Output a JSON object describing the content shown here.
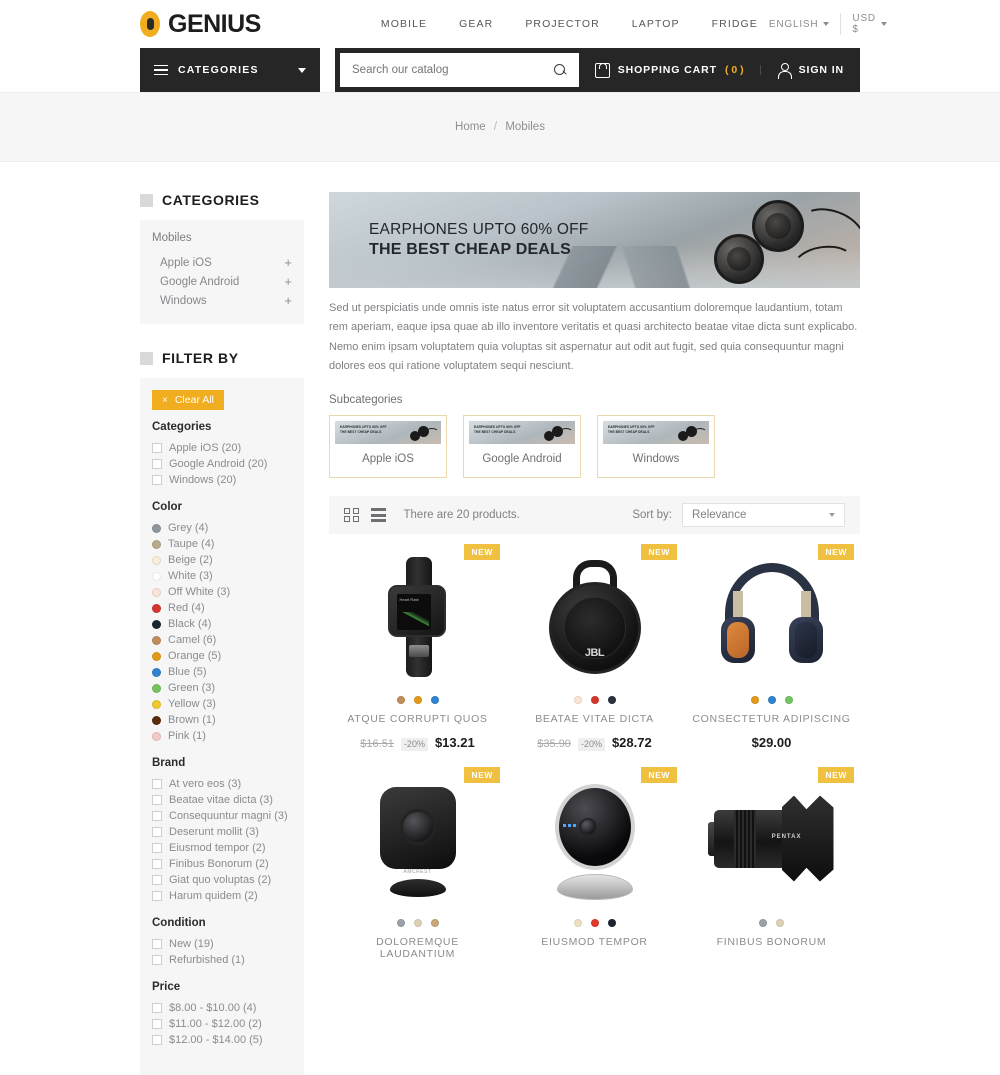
{
  "header": {
    "brand": "GENIUS",
    "nav": [
      "MOBILE",
      "GEAR",
      "PROJECTOR",
      "LAPTOP",
      "FRIDGE"
    ],
    "language": "ENGLISH",
    "currency": "USD $"
  },
  "darkbar": {
    "categories_label": "CATEGORIES",
    "search_placeholder": "Search our catalog",
    "cart_label": "SHOPPING CART",
    "cart_count": "( 0 )",
    "signin_label": "SIGN IN"
  },
  "breadcrumb": {
    "home": "Home",
    "sep": "/",
    "current": "Mobiles"
  },
  "sidebar": {
    "categories_title": "CATEGORIES",
    "root": "Mobiles",
    "items": [
      {
        "label": "Apple iOS",
        "expand": "+"
      },
      {
        "label": "Google Android",
        "expand": "+"
      },
      {
        "label": "Windows",
        "expand": "+"
      }
    ],
    "filter_title": "FILTER BY",
    "clear_all": "Clear All",
    "clear_x": "×",
    "groups": [
      {
        "name": "Categories",
        "type": "checkbox",
        "options": [
          "Apple iOS (20)",
          "Google Android (20)",
          "Windows (20)"
        ]
      },
      {
        "name": "Color",
        "type": "swatch",
        "options": [
          {
            "label": "Grey (4)",
            "color": "#8f969c"
          },
          {
            "label": "Taupe (4)",
            "color": "#b9ab8a"
          },
          {
            "label": "Beige (2)",
            "color": "#f6efd9"
          },
          {
            "label": "White (3)",
            "color": "#ffffff"
          },
          {
            "label": "Off White (3)",
            "color": "#fbe3d6"
          },
          {
            "label": "Red (4)",
            "color": "#d2362c"
          },
          {
            "label": "Black (4)",
            "color": "#1e2532"
          },
          {
            "label": "Camel (6)",
            "color": "#c08d5d"
          },
          {
            "label": "Orange (5)",
            "color": "#e39a18"
          },
          {
            "label": "Blue (5)",
            "color": "#3183d0"
          },
          {
            "label": "Green (3)",
            "color": "#76c461"
          },
          {
            "label": "Yellow (3)",
            "color": "#f0c92b"
          },
          {
            "label": "Brown (1)",
            "color": "#5a2b0c"
          },
          {
            "label": "Pink (1)",
            "color": "#f2cbc7"
          }
        ]
      },
      {
        "name": "Brand",
        "type": "checkbox",
        "options": [
          "At vero eos (3)",
          "Beatae vitae dicta (3)",
          "Consequuntur magni (3)",
          "Deserunt mollit (3)",
          "Eiusmod tempor (2)",
          "Finibus Bonorum (2)",
          "Giat quo voluptas (2)",
          "Harum quidem (2)"
        ]
      },
      {
        "name": "Condition",
        "type": "checkbox",
        "options": [
          "New (19)",
          "Refurbished (1)"
        ]
      },
      {
        "name": "Price",
        "type": "checkbox",
        "options": [
          "$8.00 - $10.00 (4)",
          "$11.00 - $12.00 (2)",
          "$12.00 - $14.00 (5)"
        ]
      }
    ]
  },
  "hero": {
    "line1": "EARPHONES UPTO 60% OFF",
    "line2": "THE BEST CHEAP DEALS",
    "description": "Sed ut perspiciatis unde omnis iste natus error sit voluptatem accusantium doloremque laudantium, totam rem aperiam, eaque ipsa quae ab illo inventore veritatis et quasi architecto beatae vitae dicta sunt explicabo. Nemo enim ipsam voluptatem quia voluptas sit aspernatur aut odit aut fugit, sed quia consequuntur magni dolores eos qui ratione voluptatem sequi nesciunt."
  },
  "subcategories": {
    "title": "Subcategories",
    "thumb_line1": "EARPHONES UPTO 60% OFF",
    "thumb_line2": "THE BEST CHEAP DEALS",
    "items": [
      {
        "name": "Apple iOS"
      },
      {
        "name": "Google Android"
      },
      {
        "name": "Windows"
      }
    ]
  },
  "toolbar": {
    "grid_icon": "grid-view-icon",
    "list_icon": "list-view-icon",
    "product_count": "There are 20 products.",
    "sort_label": "Sort by:",
    "sort_value": "Relevance"
  },
  "products": [
    {
      "badge": "NEW",
      "art": "watch",
      "name": "ATQUE CORRUPTI QUOS",
      "old_price": "$16.51",
      "discount": "-20%",
      "price": "$13.21",
      "swatches": [
        "#c08d5d",
        "#e39a18",
        "#3183d0"
      ]
    },
    {
      "badge": "NEW",
      "art": "jbl",
      "name": "BEATAE VITAE DICTA",
      "old_price": "$35.90",
      "discount": "-20%",
      "price": "$28.72",
      "swatches": [
        "#fbe3d6",
        "#d2362c",
        "#2b3140"
      ]
    },
    {
      "badge": "NEW",
      "art": "headphones",
      "name": "CONSECTETUR ADIPISCING",
      "old_price": "",
      "discount": "",
      "price": "$29.00",
      "swatches": [
        "#e39a18",
        "#3183d0",
        "#76c461"
      ]
    },
    {
      "badge": "NEW",
      "art": "dome",
      "name": "DOLOREMQUE LAUDANTIUM",
      "old_price": "",
      "discount": "",
      "price": "",
      "swatches": [
        "#9aa2a9",
        "#ddd2b6",
        "#c8a878"
      ]
    },
    {
      "badge": "NEW",
      "art": "camcube",
      "name": "EIUSMOD TEMPOR",
      "old_price": "",
      "discount": "",
      "price": "",
      "swatches": [
        "#f0e0c0",
        "#e0392b",
        "#1e2532"
      ]
    },
    {
      "badge": "NEW",
      "art": "lens",
      "name": "FINIBUS BONORUM",
      "old_price": "",
      "discount": "",
      "price": "",
      "swatches": [
        "#9aa2a9",
        "#ddd2b6"
      ]
    }
  ],
  "product_art_labels": {
    "jbl": "JBL",
    "camcube": "AMCREST",
    "lens": "PENTAX"
  },
  "colors": {
    "accent": "#f0ad1f",
    "badge": "#f0c040",
    "dark": "#262626"
  }
}
